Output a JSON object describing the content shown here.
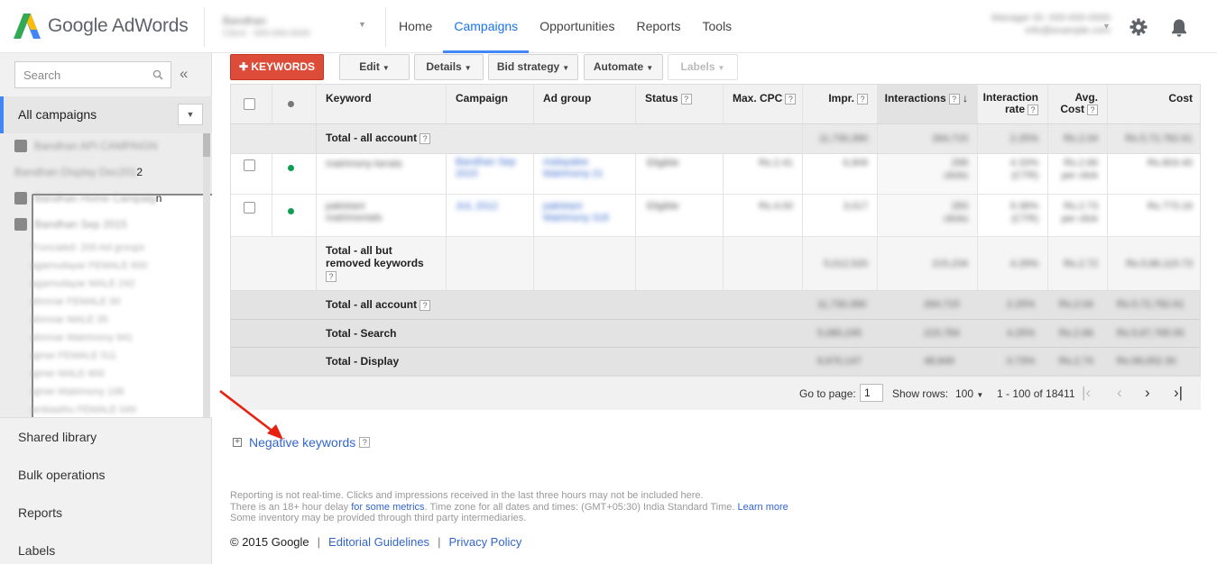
{
  "header": {
    "logo_text": "Google AdWords",
    "account_name": "Bandhan",
    "account_sub": "Client · 000-000-0000",
    "nav": [
      "Home",
      "Campaigns",
      "Opportunities",
      "Reports",
      "Tools"
    ],
    "active_nav": "Campaigns",
    "customer_id": "Manager ID: 000-000-0000",
    "customer_email": "info@example.com",
    "icons": [
      "google-ads-logo-icon",
      "gear-icon",
      "bell-icon"
    ]
  },
  "sidebar": {
    "search_placeholder": "Search",
    "collapse": "«",
    "all_campaigns": "All campaigns",
    "campaigns": [
      {
        "name": "Bandhan API CAMPAIGN",
        "tail": ""
      },
      {
        "name": "Bandhan Display Dec201",
        "tail": "2"
      },
      {
        "name": "Bandhan Home Campaig",
        "tail": "n"
      },
      {
        "name": "Bandhan Sep 2015",
        "tail": ""
      }
    ],
    "ad_groups": [
      "Truncated: 200 Ad groups",
      "agamudayar FEMALE 600",
      "agamudayar MALE 242",
      "ahmnar FEMALE 90",
      "ahmnar MALE 35",
      "ahmnar Matrimony 941",
      "ajmer FEMALE 511",
      "ajmer MALE 600",
      "ajmer Matrimony 198",
      "ambasthu FEMALE 049"
    ],
    "links": [
      "Shared library",
      "Bulk operations",
      "Reports",
      "Labels"
    ]
  },
  "toolbar": {
    "keywords_btn": "KEYWORDS",
    "edit": "Edit",
    "details": "Details",
    "bid_strategy": "Bid strategy",
    "automate": "Automate",
    "labels": "Labels"
  },
  "table": {
    "headers": {
      "keyword": "Keyword",
      "campaign": "Campaign",
      "ad_group": "Ad group",
      "status": "Status",
      "max_cpc": "Max. CPC",
      "impr": "Impr.",
      "interactions": "Interactions",
      "interaction_rate_1": "Interaction",
      "interaction_rate_2": "rate",
      "avg_cost_1": "Avg.",
      "avg_cost_2": "Cost",
      "cost": "Cost"
    },
    "total_account_top": {
      "label": "Total - all account",
      "impr": "11,730,390",
      "interactions": "264,715",
      "rate": "2.25%",
      "avg_cost": "Rs.2.04",
      "cost": "Rs.5,72,782.61"
    },
    "rows": [
      {
        "keyword": "matrimony kerala",
        "campaign": "Bandhan Sep 2015",
        "ad_group": "malayalee Matrimony 21",
        "status": "Eligible",
        "max_cpc": "Rs.2.41",
        "impr": "6,909",
        "interactions": "299",
        "interactions_sub": "clicks",
        "rate": "4.33%",
        "rate_sub": "(CTR)",
        "avg_cost": "Rs.2.66",
        "avg_cost_sub": "per click",
        "cost": "Rs.803.40"
      },
      {
        "keyword": "pakistani matrimonials",
        "campaign": "JUL 2012",
        "ad_group": "pakistani Matrimony 318",
        "status": "Eligible",
        "max_cpc": "Rs.4.00",
        "impr": "3,017",
        "interactions": "283",
        "interactions_sub": "clicks",
        "rate": "9.38%",
        "rate_sub": "(CTR)",
        "avg_cost": "Rs.2.73",
        "avg_cost_sub": "per click",
        "cost": "Rs.773.16"
      }
    ],
    "total_but_removed": {
      "label_1": "Total - all but",
      "label_2": "removed keywords",
      "impr": "5,012,520",
      "interactions": "215,234",
      "rate": "4.29%",
      "avg_cost": "Rs.2.72",
      "cost": "Rs.5,86,115.73"
    },
    "footer_totals": [
      {
        "label": "Total - all account",
        "impr": "11,730,390",
        "interactions": "264,715",
        "rate": "2.25%",
        "avg_cost": "Rs.2.04",
        "cost": "Rs.5,72,782.61"
      },
      {
        "label": "Total - Search",
        "impr": "5,080,245",
        "interactions": "215,784",
        "rate": "4.25%",
        "avg_cost": "Rs.2.66",
        "cost": "Rs.5,67,765.55"
      },
      {
        "label": "Total - Display",
        "impr": "6,670,147",
        "interactions": "48,849",
        "rate": "0.73%",
        "avg_cost": "Rs.2.74",
        "cost": "Rs.99,052.30"
      }
    ],
    "pager": {
      "go_to_page_label": "Go to page:",
      "page": "1",
      "show_rows_label": "Show rows:",
      "rows": "100",
      "range": "1 - 100 of 18411"
    }
  },
  "negative_keywords": "Negative keywords",
  "disclaimer": {
    "line1": "Reporting is not real-time. Clicks and impressions received in the last three hours may not be included here.",
    "line2_pre": "There is an 18+ hour delay ",
    "line2_link": "for some metrics",
    "line2_post": ". Time zone for all dates and times: (GMT+05:30) India Standard Time. ",
    "line2_link2": "Learn more",
    "line3": "Some inventory may be provided through third party intermediaries."
  },
  "footer": {
    "copyright": "© 2015 Google",
    "editorial": "Editorial Guidelines",
    "privacy": "Privacy Policy"
  },
  "colors": {
    "accent_blue": "#4285f4",
    "link_blue": "#3366cc",
    "keywords_red": "#dd4b39",
    "status_green": "#0f9d58",
    "arrow_red": "#e8210f"
  }
}
